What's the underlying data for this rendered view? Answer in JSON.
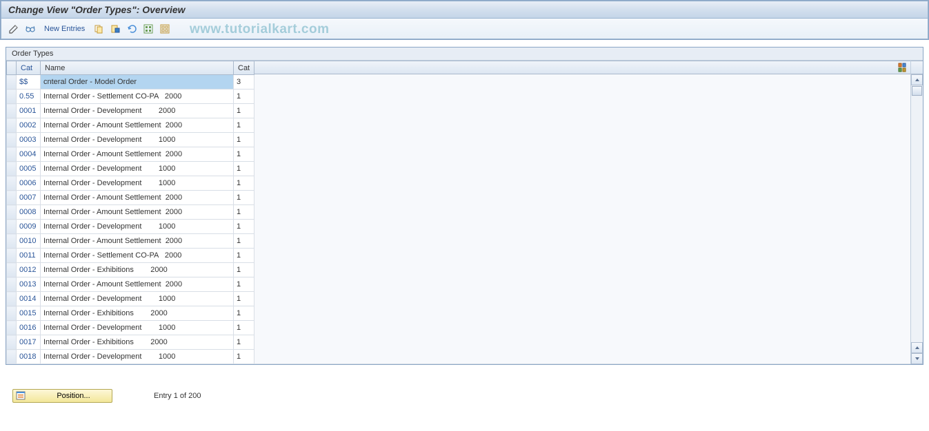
{
  "header": {
    "title": "Change View \"Order Types\": Overview"
  },
  "toolbar": {
    "new_entries_label": "New Entries"
  },
  "watermark": "www.tutorialkart.com",
  "panel": {
    "title": "Order Types"
  },
  "columns": {
    "cat1": "Cat",
    "name": "Name",
    "cat2": "Cat"
  },
  "rows": [
    {
      "cat": "$$",
      "name": "cnteral Order - Model Order",
      "cat2": "3",
      "selected": true
    },
    {
      "cat": "0.55",
      "name": "Internal Order - Settlement CO-PA   2000",
      "cat2": "1"
    },
    {
      "cat": "0001",
      "name": "Internal Order - Development        2000",
      "cat2": "1"
    },
    {
      "cat": "0002",
      "name": "Internal Order - Amount Settlement  2000",
      "cat2": "1"
    },
    {
      "cat": "0003",
      "name": "Internal Order - Development        1000",
      "cat2": "1"
    },
    {
      "cat": "0004",
      "name": "Internal Order - Amount Settlement  2000",
      "cat2": "1"
    },
    {
      "cat": "0005",
      "name": "Internal Order - Development        1000",
      "cat2": "1"
    },
    {
      "cat": "0006",
      "name": "Internal Order - Development        1000",
      "cat2": "1"
    },
    {
      "cat": "0007",
      "name": "Internal Order - Amount Settlement  2000",
      "cat2": "1"
    },
    {
      "cat": "0008",
      "name": "Internal Order - Amount Settlement  2000",
      "cat2": "1"
    },
    {
      "cat": "0009",
      "name": "Internal Order - Development        1000",
      "cat2": "1"
    },
    {
      "cat": "0010",
      "name": "Internal Order - Amount Settlement  2000",
      "cat2": "1"
    },
    {
      "cat": "0011",
      "name": "Internal Order - Settlement CO-PA   2000",
      "cat2": "1"
    },
    {
      "cat": "0012",
      "name": "Internal Order - Exhibitions        2000",
      "cat2": "1"
    },
    {
      "cat": "0013",
      "name": "Internal Order - Amount Settlement  2000",
      "cat2": "1"
    },
    {
      "cat": "0014",
      "name": "Internal Order - Development        1000",
      "cat2": "1"
    },
    {
      "cat": "0015",
      "name": "Internal Order - Exhibitions        2000",
      "cat2": "1"
    },
    {
      "cat": "0016",
      "name": "Internal Order - Development        1000",
      "cat2": "1"
    },
    {
      "cat": "0017",
      "name": "Internal Order - Exhibitions        2000",
      "cat2": "1"
    },
    {
      "cat": "0018",
      "name": "Internal Order - Development        1000",
      "cat2": "1"
    }
  ],
  "footer": {
    "position_label": "Position...",
    "entry_text": "Entry 1 of 200"
  }
}
